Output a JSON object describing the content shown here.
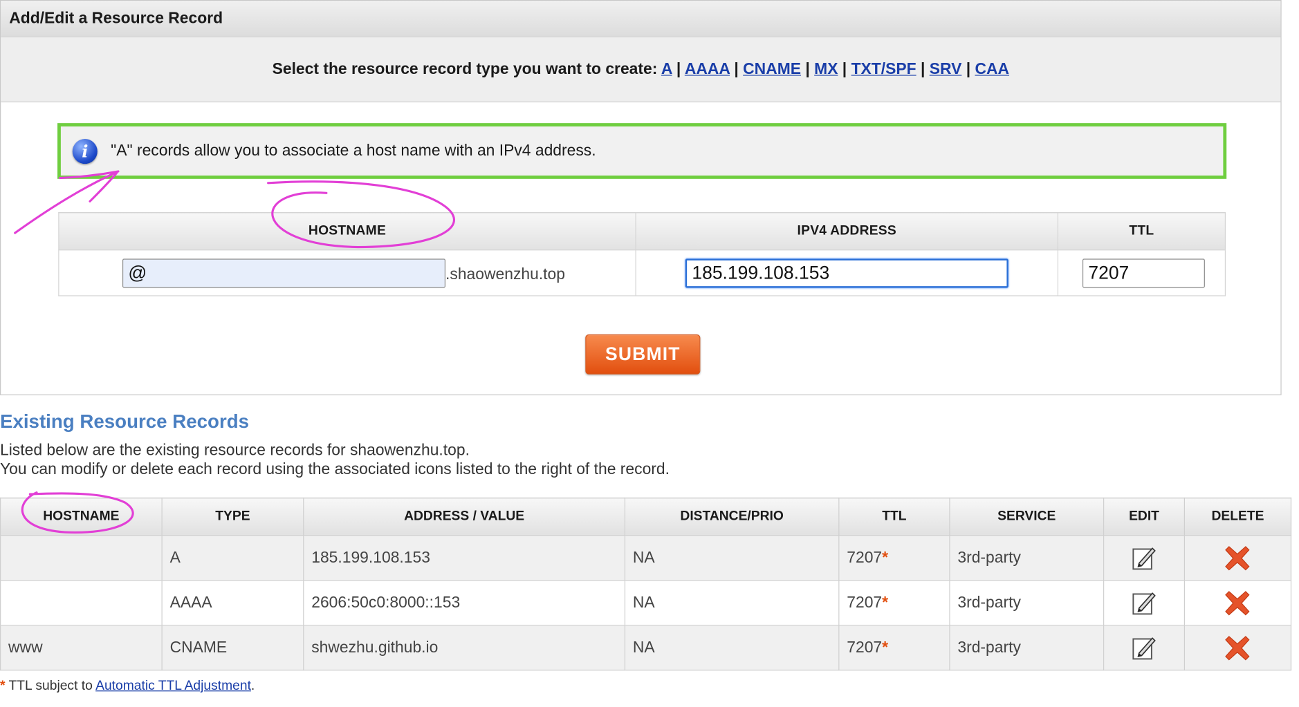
{
  "panel": {
    "title": "Add/Edit a Resource Record",
    "type_prompt": "Select the resource record type you want to create:",
    "types": [
      "A",
      "AAAA",
      "CNAME",
      "MX",
      "TXT/SPF",
      "SRV",
      "CAA"
    ],
    "info_text": "\"A\" records allow you to associate a host name with an IPv4 address.",
    "form": {
      "headers": [
        "HOSTNAME",
        "IPV4 ADDRESS",
        "TTL"
      ],
      "hostname_value": "@",
      "domain_suffix": ".shaowenzhu.top",
      "ipv4_value": "185.199.108.153",
      "ttl_value": "7207"
    },
    "submit_label": "SUBMIT"
  },
  "existing": {
    "title": "Existing Resource Records",
    "desc_line1": "Listed below are the existing resource records for shaowenzhu.top.",
    "desc_line2": "You can modify or delete each record using the associated icons listed to the right of the record.",
    "headers": [
      "HOSTNAME",
      "TYPE",
      "ADDRESS / VALUE",
      "DISTANCE/PRIO",
      "TTL",
      "SERVICE",
      "EDIT",
      "DELETE"
    ],
    "rows": [
      {
        "hostname": "",
        "type": "A",
        "value": "185.199.108.153",
        "prio": "NA",
        "ttl": "7207",
        "service": "3rd-party"
      },
      {
        "hostname": "",
        "type": "AAAA",
        "value": "2606:50c0:8000::153",
        "prio": "NA",
        "ttl": "7207",
        "service": "3rd-party"
      },
      {
        "hostname": "www",
        "type": "CNAME",
        "value": "shwezhu.github.io",
        "prio": "NA",
        "ttl": "7207",
        "service": "3rd-party"
      }
    ]
  },
  "footnote": {
    "asterisk": "*",
    "text": " TTL subject to ",
    "link": "Automatic TTL Adjustment",
    "end": "."
  },
  "colors": {
    "info_border": "#6fce3f",
    "submit": "#e24f0f",
    "link": "#1a3ea8",
    "section_title": "#4a7fc1",
    "annotation": "#e23fd6"
  },
  "icons": {
    "info": "info-icon",
    "edit": "edit-pencil-icon",
    "delete": "delete-x-icon"
  }
}
